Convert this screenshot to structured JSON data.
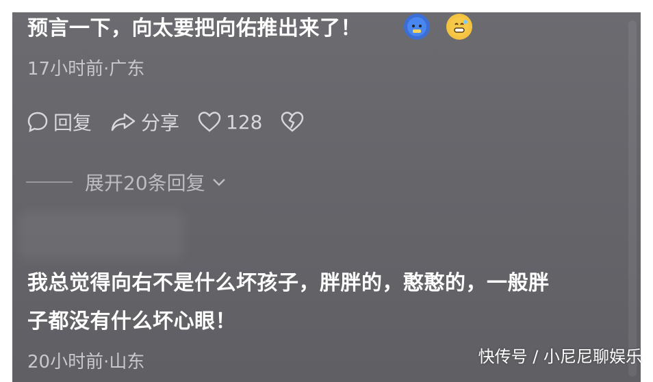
{
  "comment1": {
    "text": "预言一下，向太要把向佑推出来了！",
    "emoji1": "cold-face-emoji",
    "emoji2": "grinning-sweat-emoji",
    "meta": "17小时前·广东"
  },
  "actions": {
    "reply_label": "回复",
    "share_label": "分享",
    "like_count": "128"
  },
  "expand_label": "展开20条回复",
  "comment2": {
    "line1": "我总觉得向右不是什么坏孩子，胖胖的，憨憨的，一般胖",
    "line2": "子都没有什么坏心眼！",
    "meta": "20小时前·山东"
  },
  "watermark": "快传号 / 小尼尼聊娱乐"
}
